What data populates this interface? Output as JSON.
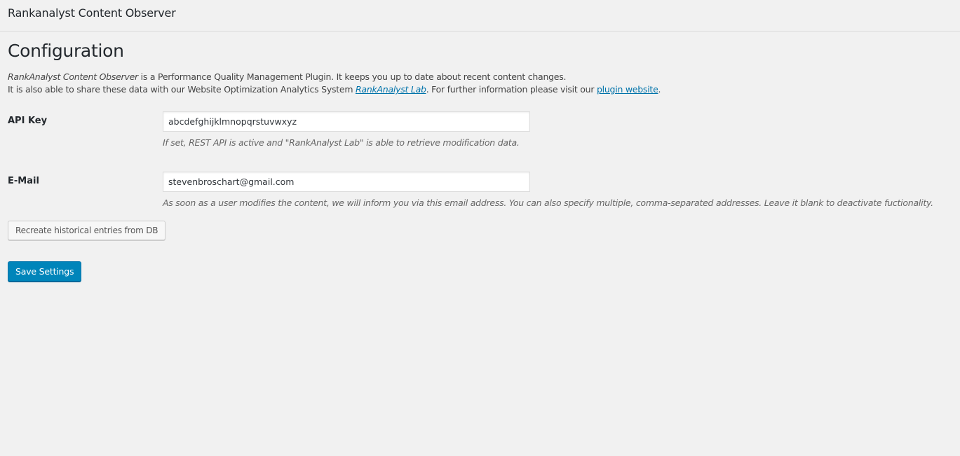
{
  "header": {
    "plugin_title": "Rankanalyst Content Observer"
  },
  "page": {
    "title": "Configuration"
  },
  "intro": {
    "line1_product_name": "RankAnalyst Content Observer",
    "line1_text": " is a Performance Quality Management Plugin. It keeps you up to date about recent content changes.",
    "line2_text_before": "It is also able to share these data with our Website Optimization Analytics System ",
    "lab_link_label": "RankAnalyst Lab",
    "line2_text_middle": ". For further information please visit our ",
    "website_link_label": "plugin website",
    "line2_text_after": "."
  },
  "fields": {
    "api_key": {
      "label": "API Key",
      "value": "abcdefghijklmnopqrstuvwxyz",
      "description": "If set, REST API is active and \"RankAnalyst Lab\" is able to retrieve modification data."
    },
    "email": {
      "label": "E-Mail",
      "value": "stevenbroschart@gmail.com",
      "description": "As soon as a user modifies the content, we will inform you via this email address. You can also specify multiple, comma-separated addresses. Leave it blank to deactivate fuctionality."
    }
  },
  "buttons": {
    "recreate_label": "Recreate historical entries from DB",
    "save_label": "Save Settings"
  },
  "colors": {
    "background": "#f1f1f1",
    "link": "#0073aa",
    "primary_button": "#0085ba"
  }
}
